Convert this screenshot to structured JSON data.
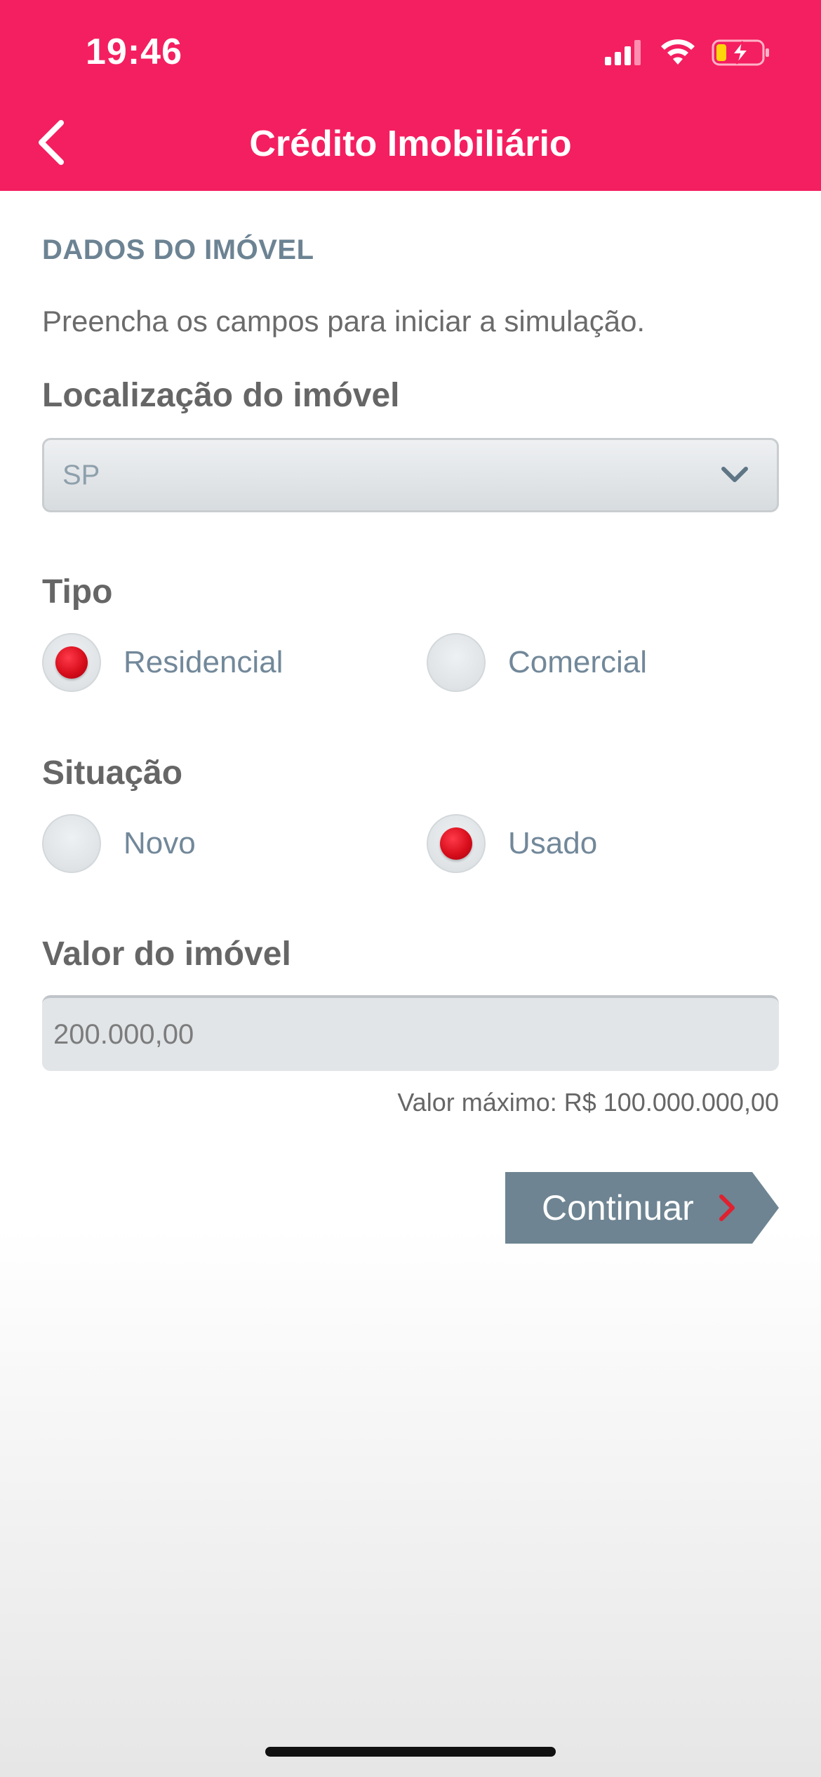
{
  "status_bar": {
    "time": "19:46",
    "icons": [
      "signal-icon",
      "wifi-icon",
      "battery-charging-icon"
    ]
  },
  "header": {
    "title": "Crédito Imobiliário",
    "back_icon": "chevron-left-icon",
    "background": "#f41f60"
  },
  "form": {
    "section_title": "DADOS DO IMÓVEL",
    "subtitle": "Preencha os campos para iniciar a simulação.",
    "location": {
      "label": "Localização do imóvel",
      "value": "SP"
    },
    "tipo": {
      "label": "Tipo",
      "options": [
        {
          "label": "Residencial",
          "selected": true
        },
        {
          "label": "Comercial",
          "selected": false
        }
      ]
    },
    "situacao": {
      "label": "Situação",
      "options": [
        {
          "label": "Novo",
          "selected": false
        },
        {
          "label": "Usado",
          "selected": true
        }
      ]
    },
    "valor": {
      "label": "Valor do imóvel",
      "value": "200.000,00",
      "hint": "Valor máximo: R$ 100.000.000,00"
    },
    "continue_label": "Continuar"
  },
  "colors": {
    "accent": "#f41f60",
    "radio_selected": "#d80e1c",
    "button": "#6e8492"
  }
}
